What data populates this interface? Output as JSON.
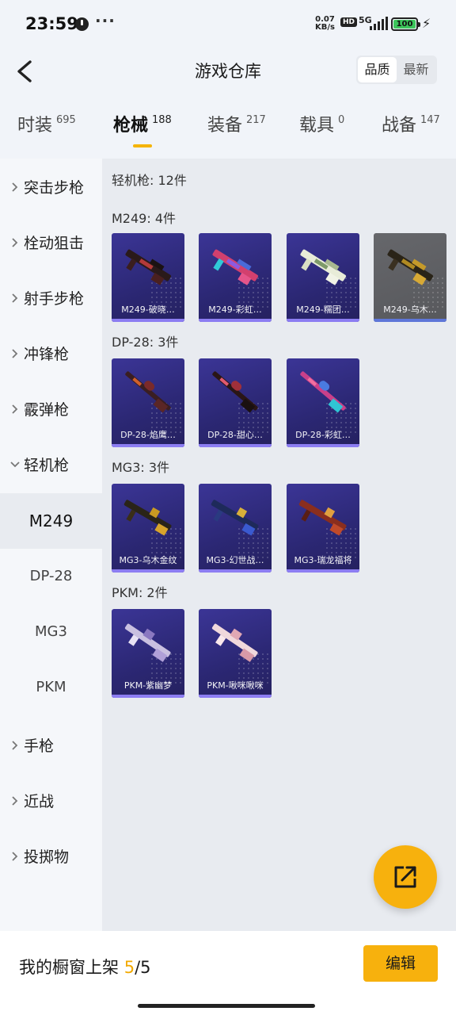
{
  "status_bar": {
    "time": "23:59",
    "more": "···",
    "net_speed_value": "0.07",
    "net_speed_unit": "KB/s",
    "hd": "HD",
    "network": "5G",
    "battery": "100"
  },
  "header": {
    "title": "游戏仓库",
    "sort_quality": "品质",
    "sort_newest": "最新"
  },
  "tabs": [
    {
      "label": "时装",
      "count": "695"
    },
    {
      "label": "枪械",
      "count": "188"
    },
    {
      "label": "装备",
      "count": "217"
    },
    {
      "label": "载具",
      "count": "0"
    },
    {
      "label": "战备",
      "count": "147"
    }
  ],
  "sidebar": {
    "categories": [
      {
        "label": "突击步枪"
      },
      {
        "label": "栓动狙击"
      },
      {
        "label": "射手步枪"
      },
      {
        "label": "冲锋枪"
      },
      {
        "label": "霰弹枪"
      },
      {
        "label": "轻机枪"
      },
      {
        "label": "手枪"
      },
      {
        "label": "近战"
      },
      {
        "label": "投掷物"
      }
    ],
    "subcategories": [
      {
        "label": "M249"
      },
      {
        "label": "DP-28"
      },
      {
        "label": "MG3"
      },
      {
        "label": "PKM"
      }
    ]
  },
  "content": {
    "summary": "轻机枪: 12件",
    "groups": [
      {
        "title": "M249: 4件",
        "items": [
          "M249-破晓…",
          "M249-彩虹…",
          "M249-糯团…",
          "M249-乌木…"
        ]
      },
      {
        "title": "DP-28: 3件",
        "items": [
          "DP-28-焰鹰…",
          "DP-28-甜心…",
          "DP-28-彩虹…"
        ]
      },
      {
        "title": "MG3: 3件",
        "items": [
          "MG3-乌木金纹",
          "MG3-幻世战…",
          "MG3-瑞龙福将"
        ]
      },
      {
        "title": "PKM: 2件",
        "items": [
          "PKM-紫幽梦",
          "PKM-啾咪啾咪"
        ]
      }
    ]
  },
  "bottom_bar": {
    "showcase_label": "我的橱窗上架",
    "showcase_current": "5",
    "showcase_sep": "/",
    "showcase_total": "5",
    "edit_label": "编辑"
  },
  "colors": {
    "accent": "#f7b10d",
    "card_bg": "#2e2a7a",
    "card_bar": "#8c7df2"
  }
}
